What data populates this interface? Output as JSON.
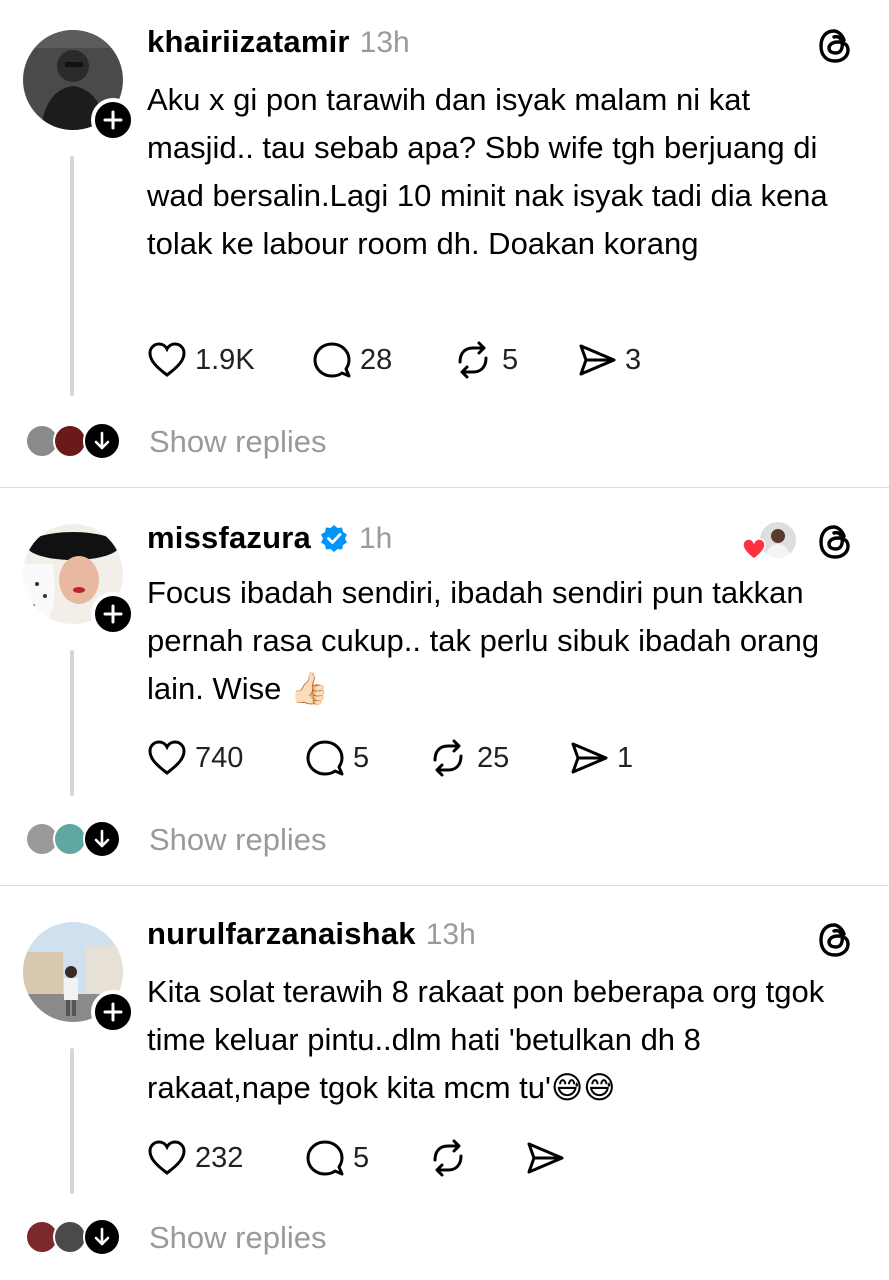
{
  "posts": [
    {
      "username": "khairiizatamir",
      "time": "13h",
      "verified": false,
      "text": "Aku x gi pon tarawih dan isyak malam ni kat masjid.. tau sebab apa? Sbb wife tgh berjuang di wad bersalin.Lagi 10 minit nak isyak tadi dia kena tolak ke labour room dh. Doakan korang",
      "likes": "1.9K",
      "comments": "28",
      "reposts": "5",
      "shares": "3",
      "show_replies": "Show replies"
    },
    {
      "username": "missfazura",
      "time": "1h",
      "verified": true,
      "text": "Focus ibadah sendiri, ibadah sendiri pun takkan pernah rasa cukup.. tak perlu sibuk ibadah orang lain. Wise 👍🏻",
      "likes": "740",
      "comments": "5",
      "reposts": "25",
      "shares": "1",
      "show_replies": "Show replies"
    },
    {
      "username": "nurulfarzanaishak",
      "time": "13h",
      "verified": false,
      "text": "Kita solat terawih 8 rakaat pon beberapa org tgok time keluar pintu..dlm hati 'betulkan dh 8 rakaat,nape tgok kita mcm tu'😅😅",
      "likes": "232",
      "comments": "5",
      "reposts": "",
      "shares": "",
      "show_replies": "Show replies"
    }
  ],
  "icons": {
    "like": "heart-icon",
    "comment": "comment-bubble-icon",
    "repost": "repost-icon",
    "share": "send-icon",
    "app": "threads-logo-icon",
    "follow": "plus-icon",
    "expand": "arrow-down-icon",
    "verified": "verified-badge-icon"
  },
  "colors": {
    "verified": "#0095f6",
    "liked_heart": "#ff3040",
    "muted_text": "#9a9a9a"
  }
}
